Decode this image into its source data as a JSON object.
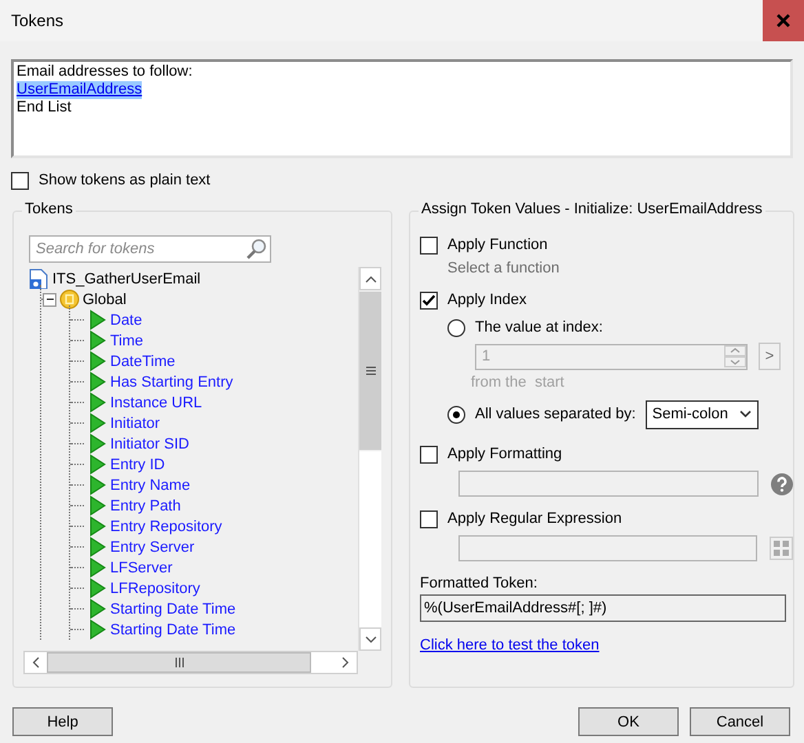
{
  "window": {
    "title": "Tokens"
  },
  "editor": {
    "lines": [
      {
        "text": "Email addresses to follow:",
        "kind": "text"
      },
      {
        "text": "UserEmailAddress",
        "kind": "token",
        "selected": true
      },
      {
        "text": "End List",
        "kind": "text"
      }
    ]
  },
  "show_plain_text": {
    "label": "Show tokens as plain text",
    "checked": false
  },
  "tokens_panel": {
    "title": "Tokens",
    "search": {
      "placeholder": "Search for tokens"
    },
    "tree": [
      {
        "label": "ITS_GatherUserEmail",
        "kind": "workflow",
        "children": [
          {
            "label": "Global",
            "kind": "group",
            "expanded": true,
            "children": [
              {
                "label": "Date",
                "kind": "token"
              },
              {
                "label": "Time",
                "kind": "token"
              },
              {
                "label": "DateTime",
                "kind": "token"
              },
              {
                "label": "Has Starting Entry",
                "kind": "token"
              },
              {
                "label": "Instance URL",
                "kind": "token"
              },
              {
                "label": "Initiator",
                "kind": "token"
              },
              {
                "label": "Initiator SID",
                "kind": "token"
              },
              {
                "label": "Entry ID",
                "kind": "token"
              },
              {
                "label": "Entry Name",
                "kind": "token"
              },
              {
                "label": "Entry Path",
                "kind": "token"
              },
              {
                "label": "Entry Repository",
                "kind": "token"
              },
              {
                "label": "Entry Server",
                "kind": "token"
              },
              {
                "label": "LFServer",
                "kind": "token"
              },
              {
                "label": "LFRepository",
                "kind": "token"
              },
              {
                "label": "Starting Date Time",
                "kind": "token"
              },
              {
                "label": "Starting Date Time",
                "kind": "token"
              }
            ]
          }
        ]
      }
    ]
  },
  "assign_panel": {
    "title": "Assign Token Values - Initialize: UserEmailAddress",
    "apply_function": {
      "label": "Apply Function",
      "checked": false,
      "hint": "Select a function"
    },
    "apply_index": {
      "label": "Apply Index",
      "checked": true,
      "options": [
        {
          "label": "The value at index:",
          "selected": false,
          "value": "1",
          "button": ">",
          "note": "from the  start"
        },
        {
          "label": "All values separated by:",
          "selected": true,
          "value": "Semi-colon"
        }
      ]
    },
    "apply_formatting": {
      "label": "Apply Formatting",
      "checked": false
    },
    "apply_regex": {
      "label": "Apply Regular Expression",
      "checked": false
    },
    "formatted_token": {
      "label": "Formatted Token:",
      "value": "%(UserEmailAddress#[; ]#)"
    },
    "test_link": "Click here to test the token"
  },
  "buttons": [
    {
      "label": "Help",
      "kind": "help"
    },
    {
      "label": "OK",
      "kind": "ok"
    },
    {
      "label": "Cancel",
      "kind": "cancel"
    }
  ]
}
